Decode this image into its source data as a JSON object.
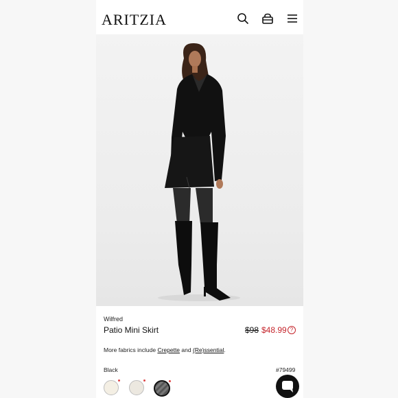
{
  "header": {
    "logo": "ARITZIA",
    "icons": [
      "search-icon",
      "bag-icon",
      "menu-icon"
    ]
  },
  "product": {
    "brand": "Wilfred",
    "name": "Patio Mini Skirt",
    "price_original": "$98",
    "price_sale": "$48.99",
    "price_help": "?",
    "fabrics_prefix": "More fabrics include",
    "fabric_1": "Crepette",
    "fabrics_and": "and",
    "fabric_2": "(Re)ssential",
    "fabrics_suffix": ".",
    "color_label": "Black",
    "sku": "#79499",
    "swatches": [
      "#f4efe4",
      "#ece8e0",
      "#666666"
    ]
  },
  "colors": {
    "sale": "#c5242b",
    "text": "#111111"
  }
}
